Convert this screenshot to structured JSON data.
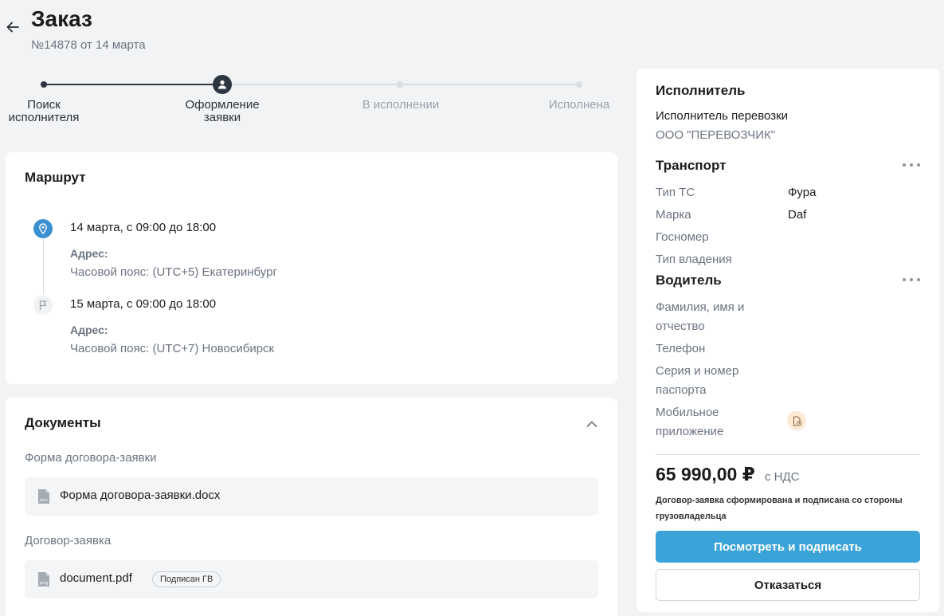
{
  "header": {
    "title": "Заказ",
    "subtitle": "№14878 от 14 марта"
  },
  "stepper": {
    "steps": [
      {
        "label": "Поиск\nисполнителя",
        "state": "done"
      },
      {
        "label": "Оформление\nзаявки",
        "state": "current"
      },
      {
        "label": "В исполнении",
        "state": "todo"
      },
      {
        "label": "Исполнена",
        "state": "todo"
      }
    ]
  },
  "route": {
    "title": "Маршрут",
    "stops": [
      {
        "date": "14 марта, с 09:00 до 18:00",
        "address_label": "Адрес:",
        "timezone": "Часовой пояс: (UTC+5) Екатеринбург",
        "icon": "location-pin-icon"
      },
      {
        "date": "15 марта, с 09:00 до 18:00",
        "address_label": "Адрес:",
        "timezone": "Часовой пояс: (UTC+7) Новосибирск",
        "icon": "flag-icon"
      }
    ]
  },
  "documents": {
    "title": "Документы",
    "sections": [
      {
        "label": "Форма договора-заявки",
        "file": {
          "name": "Форма договора-заявки.docx",
          "icon": "doc-file-icon",
          "icon_text": "doc",
          "badge": ""
        }
      },
      {
        "label": "Договор-заявка",
        "file": {
          "name": "document.pdf",
          "icon": "png-file-icon",
          "icon_text": "png",
          "badge": "Подписан ГВ"
        }
      }
    ]
  },
  "executor": {
    "title": "Исполнитель",
    "carrier_label": "Исполнитель перевозки",
    "carrier_name": "ООО \"ПЕРЕВОЗЧИК\"",
    "transport": {
      "title": "Транспорт",
      "fields": [
        {
          "label": "Тип ТС",
          "value": "Фура"
        },
        {
          "label": "Марка",
          "value": "Daf"
        },
        {
          "label": "Госномер",
          "value": ""
        },
        {
          "label": "Тип владения",
          "value": ""
        }
      ]
    },
    "driver": {
      "title": "Водитель",
      "fields": [
        {
          "label": "Фамилия, имя и\nотчество",
          "value": ""
        },
        {
          "label": "Телефон",
          "value": ""
        },
        {
          "label": "Серия и номер\nпаспорта",
          "value": ""
        },
        {
          "label": "Мобильное\nприложение",
          "value": ""
        }
      ]
    },
    "price": "65 990,00 ₽",
    "price_tax": "с НДС",
    "note": "Договор-заявка сформирована и подписана со стороны грузовладельца",
    "primary_button": "Посмотреть и подписать",
    "secondary_button": "Отказаться"
  },
  "colors": {
    "accent": "#3aa3d8",
    "pin": "#3a8fd0",
    "stepper_done": "#2d3640",
    "stepper_todo": "#d9dde2",
    "muted_text": "#6b7480"
  }
}
